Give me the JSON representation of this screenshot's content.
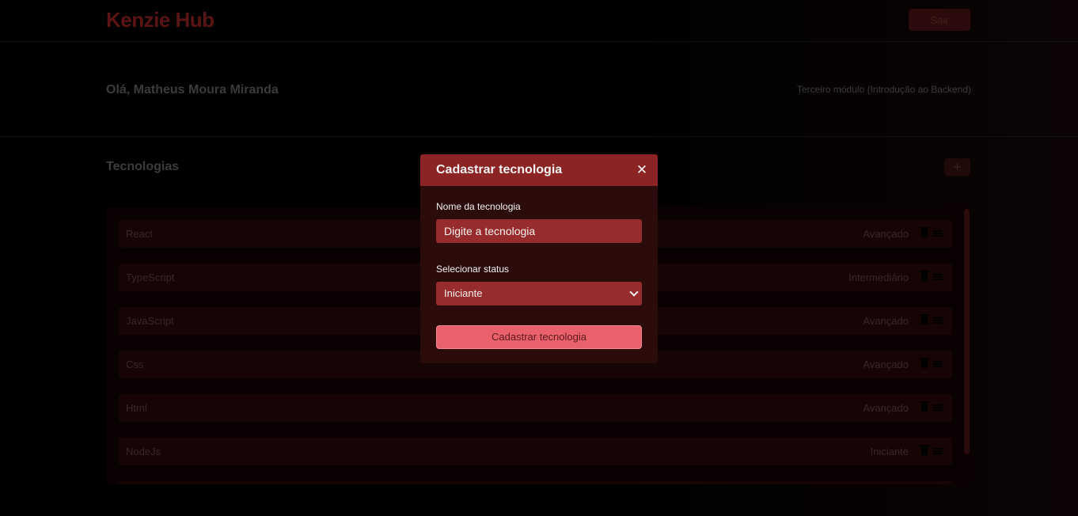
{
  "header": {
    "logo": "Kenzie Hub",
    "logout_label": "Sair"
  },
  "profile": {
    "greeting": "Olá, Matheus Moura Miranda",
    "module": "Terceiro módulo (Introdução ao Backend)"
  },
  "technologies": {
    "title": "Tecnologias",
    "add_label": "+",
    "items": [
      {
        "name": "React",
        "status": "Avançado"
      },
      {
        "name": "TypeScript",
        "status": "Intermediário"
      },
      {
        "name": "JavaScript",
        "status": "Avançado"
      },
      {
        "name": "Css",
        "status": "Avançado"
      },
      {
        "name": "Html",
        "status": "Avançado"
      },
      {
        "name": "NodeJs",
        "status": "Iniciante"
      }
    ]
  },
  "modal": {
    "title": "Cadastrar tecnologia",
    "close_label": "✕",
    "name_label": "Nome da tecnologia",
    "name_placeholder": "Digite a tecnologia",
    "status_label": "Selecionar status",
    "status_value": "Iniciante",
    "submit_label": "Cadastrar tecnologia"
  },
  "colors": {
    "modal_header": "#8c2424",
    "modal_body": "#2c0b0b",
    "input_bg": "#982b2b",
    "submit_bg": "#e8616b"
  }
}
